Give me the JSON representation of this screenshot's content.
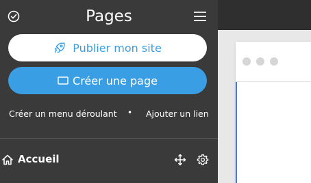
{
  "header": {
    "title": "Pages"
  },
  "buttons": {
    "publish_label": "Publier mon site",
    "create_label": "Créer une page"
  },
  "links": {
    "dropdown_label": "Créer un menu déroulant",
    "separator": "•",
    "add_link_label": "Ajouter un lien"
  },
  "pages": [
    {
      "label": "Accueil",
      "icon": "home-icon"
    }
  ],
  "colors": {
    "sidebar_bg": "#3a3a3a",
    "accent": "#3a9ee4",
    "topbar_bg": "#2f2f2f",
    "canvas_bg": "#e8e8e8"
  },
  "icons": {
    "check": "check-circle-icon",
    "menu": "hamburger-menu-icon",
    "rocket": "rocket-icon",
    "page": "page-icon",
    "move": "move-icon",
    "settings": "gear-icon"
  }
}
